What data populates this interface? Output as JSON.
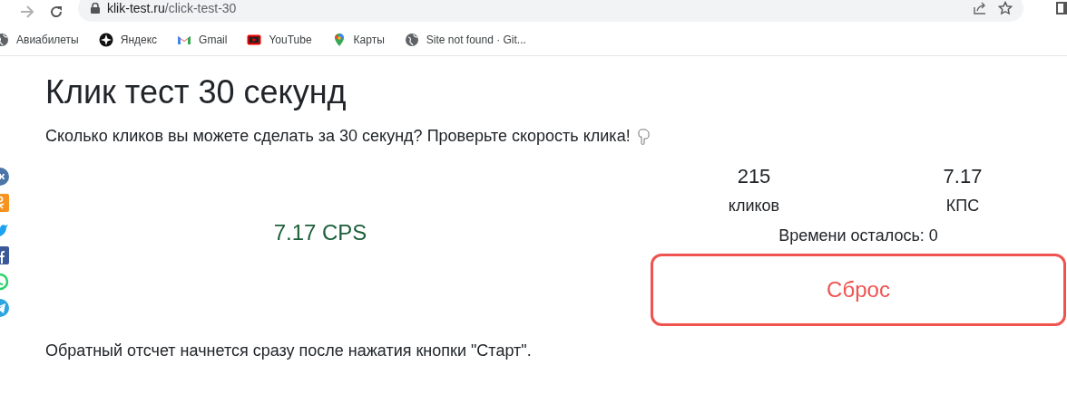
{
  "browser": {
    "url_host": "klik-test.ru",
    "url_path": "/click-test-30",
    "bookmarks": [
      {
        "label": "Авиабилеты",
        "kind": "globe"
      },
      {
        "label": "Яндекс",
        "kind": "yandex"
      },
      {
        "label": "Gmail",
        "kind": "gmail"
      },
      {
        "label": "YouTube",
        "kind": "youtube"
      },
      {
        "label": "Карты",
        "kind": "maps"
      },
      {
        "label": "Site not found · Git...",
        "kind": "globe"
      }
    ]
  },
  "social": [
    {
      "kind": "vk",
      "color": "#4a76a8"
    },
    {
      "kind": "ok",
      "color": "#f7931e"
    },
    {
      "kind": "twitter",
      "color": "#1da1f2"
    },
    {
      "kind": "facebook",
      "color": "#3b5998"
    },
    {
      "kind": "whatsapp",
      "color": "#25d366"
    },
    {
      "kind": "telegram",
      "color": "#2ca5e0"
    }
  ],
  "title": "Клик тест 30 секунд",
  "subtitle": "Сколько кликов вы можете сделать за 30 секунд? Проверьте скорость клика!",
  "result": "7.17 CPS",
  "stats": [
    {
      "value": "215",
      "label": "кликов"
    },
    {
      "value": "7.17",
      "label": "КПС"
    }
  ],
  "time_left": "Времени осталось: 0",
  "reset_button": "Сброс",
  "note": "Обратный отсчет начнется сразу после нажатия кнопки \"Старт\"."
}
